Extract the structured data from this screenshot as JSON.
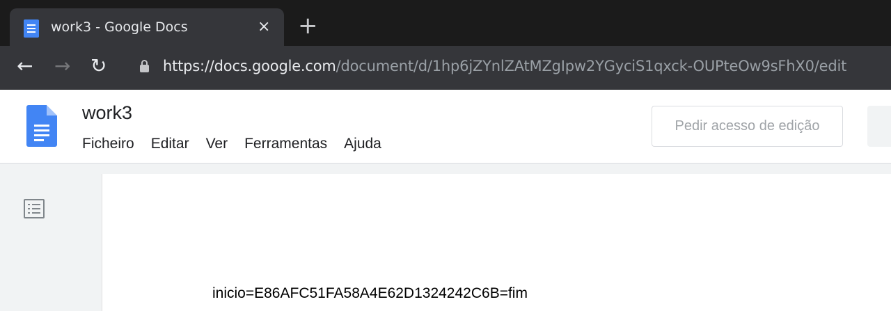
{
  "browser": {
    "tab_title": "work3 - Google Docs",
    "tab_close": "×",
    "new_tab": "+",
    "url_host": "https://docs.google.com",
    "url_path": "/document/d/1hp6jZYnlZAtMZgIpw2YGyciS1qxck-OUPteOw9sFhX0/edit",
    "nav_back": "←",
    "nav_forward": "→",
    "nav_reload": "↻"
  },
  "docs": {
    "title": "work3",
    "menu": [
      "Ficheiro",
      "Editar",
      "Ver",
      "Ferramentas",
      "Ajuda"
    ],
    "request_edit_label": "Pedir acesso de edição"
  },
  "document": {
    "body_text": "inicio=E86AFC51FA58A4E62D1324242C6B=fim"
  },
  "icons": {
    "tab_favicon": "google-docs-icon",
    "lock": "lock-icon",
    "docs_logo": "google-docs-logo",
    "outline": "document-outline-icon"
  },
  "colors": {
    "docs_blue": "#4285f4",
    "chrome_dark": "#35363a",
    "tabstrip": "#1b1b1b"
  }
}
